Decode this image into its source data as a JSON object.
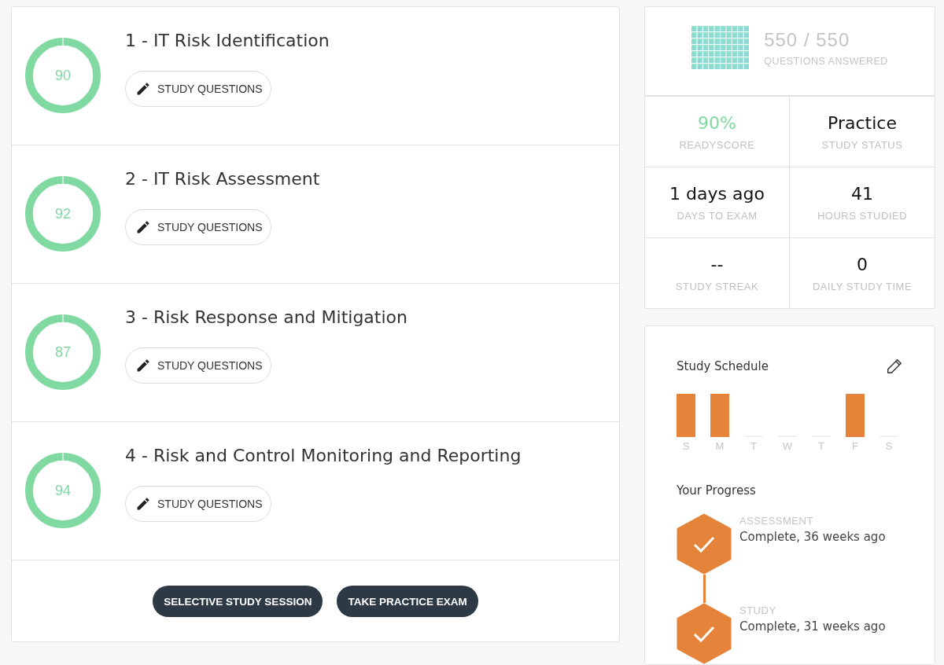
{
  "domains": [
    {
      "score": "90",
      "title": "1 - IT Risk Identification",
      "button": "STUDY QUESTIONS"
    },
    {
      "score": "92",
      "title": "2 - IT Risk Assessment",
      "button": "STUDY QUESTIONS"
    },
    {
      "score": "87",
      "title": "3 - Risk Response and Mitigation",
      "button": "STUDY QUESTIONS"
    },
    {
      "score": "94",
      "title": "4 - Risk and Control Monitoring and Reporting",
      "button": "STUDY QUESTIONS"
    }
  ],
  "actions": [
    "SELECTIVE STUDY SESSION",
    "TAKE PRACTICE EXAM"
  ],
  "answered": {
    "count": "550 / 550",
    "label": "QUESTIONS ANSWERED"
  },
  "stats": [
    {
      "value": "90%",
      "label": "READYSCORE",
      "kind": "score"
    },
    {
      "value": "1 days ago",
      "label": "DAYS TO EXAM",
      "kind": "plain"
    },
    {
      "value": "--",
      "label": "STUDY STREAK",
      "kind": "plain"
    },
    {
      "value": "Practice",
      "label": "STUDY STATUS",
      "kind": "plain"
    },
    {
      "value": "41",
      "label": "HOURS STUDIED",
      "kind": "plain"
    },
    {
      "value": "0",
      "label": "DAILY STUDY TIME",
      "kind": "plain"
    }
  ],
  "schedule": {
    "title": "Study Schedule",
    "days": [
      {
        "label": "S",
        "scheduled": true
      },
      {
        "label": "M",
        "scheduled": true
      },
      {
        "label": "T",
        "scheduled": false
      },
      {
        "label": "W",
        "scheduled": false
      },
      {
        "label": "T",
        "scheduled": false
      },
      {
        "label": "F",
        "scheduled": true
      },
      {
        "label": "S",
        "scheduled": false
      }
    ]
  },
  "progress": {
    "title": "Your Progress",
    "steps": [
      {
        "stage": "ASSESSMENT",
        "status": "Complete, 36 weeks ago"
      },
      {
        "stage": "STUDY",
        "status": "Complete, 31 weeks ago"
      }
    ]
  }
}
